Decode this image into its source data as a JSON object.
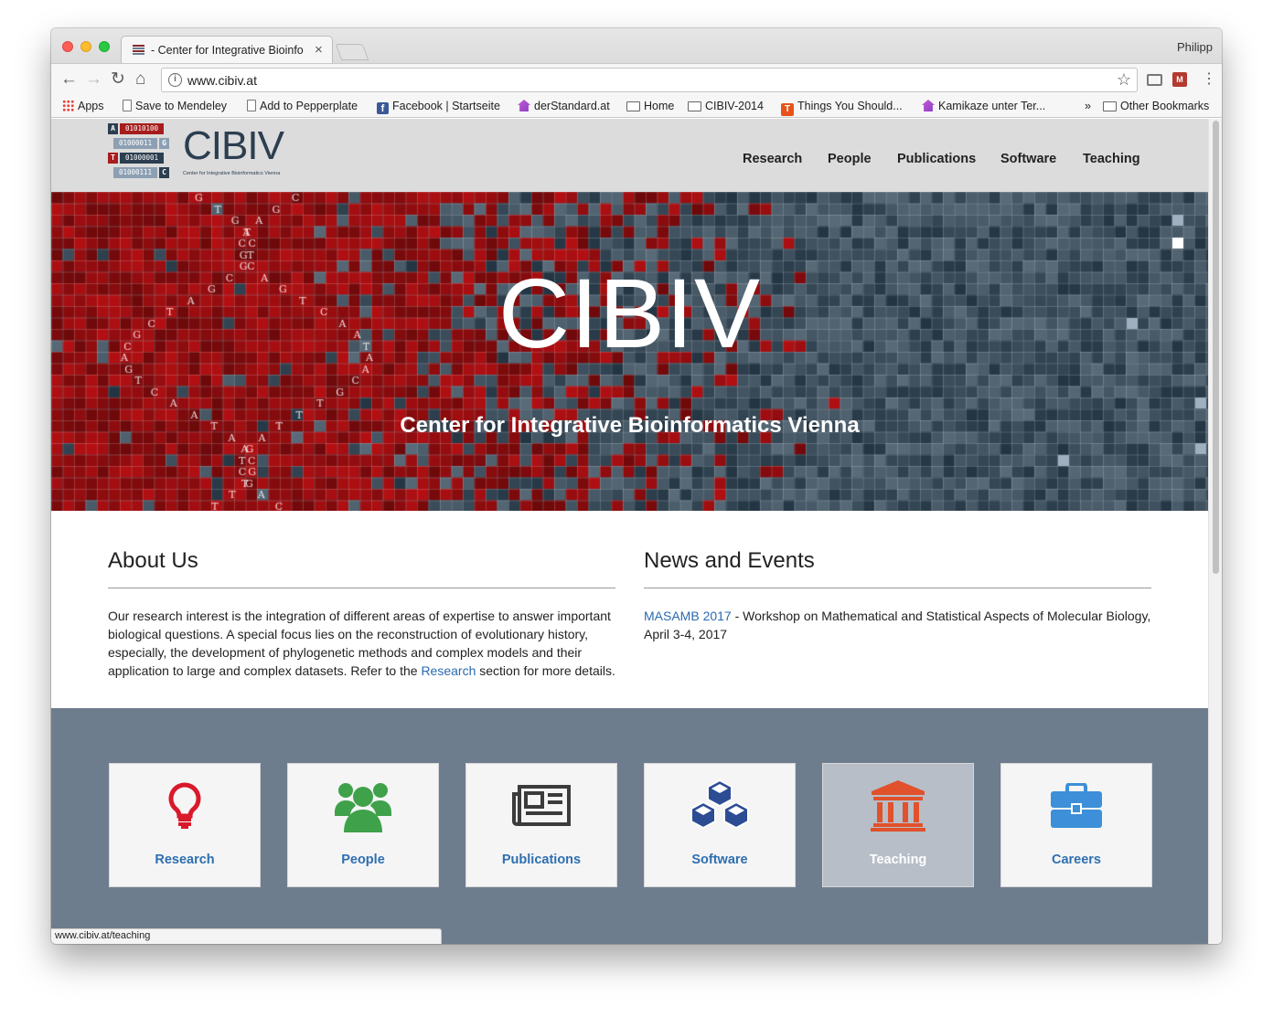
{
  "browser": {
    "tab_title": "- Center for Integrative Bioinfo",
    "tab_close": "×",
    "profile_name": "Philipp",
    "url": "www.cibiv.at",
    "status_url": "www.cibiv.at/teaching",
    "bookmarks": [
      {
        "label": "Apps",
        "icon": "apps-icon"
      },
      {
        "label": "Save to Mendeley",
        "icon": "page-icon"
      },
      {
        "label": "Add to Pepperplate",
        "icon": "page-icon"
      },
      {
        "label": "Facebook | Startseite",
        "icon": "facebook-icon"
      },
      {
        "label": "derStandard.at",
        "icon": "house-icon"
      },
      {
        "label": "Home",
        "icon": "folder-icon"
      },
      {
        "label": "CIBIV-2014",
        "icon": "folder-icon"
      },
      {
        "label": "Things You Should...",
        "icon": "t-icon"
      },
      {
        "label": "Kamikaze unter Ter...",
        "icon": "house-icon"
      }
    ],
    "bookmarks_overflow": "»",
    "other_bookmarks": "Other Bookmarks"
  },
  "site": {
    "logo": {
      "wordmark": "CIBIV",
      "subtitle": "Center for Integrative Bioinformatics Vienna",
      "rows": [
        {
          "letter": "A",
          "bits": "01010100"
        },
        {
          "letter": "G",
          "bits": "01000011"
        },
        {
          "letter": "T",
          "bits": "01000001"
        },
        {
          "letter": "C",
          "bits": "01000111"
        }
      ]
    },
    "nav": [
      "Research",
      "People",
      "Publications",
      "Software",
      "Teaching"
    ],
    "hero": {
      "title": "CIBIV",
      "subtitle": "Center for Integrative Bioinformatics Vienna"
    },
    "about": {
      "heading": "About Us",
      "text_before_link": "Our research interest is the integration of different areas of expertise to answer important biological questions. A special focus lies on the reconstruction of evolutionary history, especially, the development of phylogenetic methods and complex models and their application to large and complex datasets. Refer to the ",
      "link": "Research",
      "text_after_link": " section for more details."
    },
    "news": {
      "heading": "News and Events",
      "item_link": "MASAMB 2017",
      "item_text": " - Workshop on Mathematical and Statistical Aspects of Molecular Biology, April 3-4, 2017"
    },
    "tiles": [
      {
        "label": "Research",
        "icon": "lightbulb-icon",
        "color": "#d9192b"
      },
      {
        "label": "People",
        "icon": "people-icon",
        "color": "#3fa14a"
      },
      {
        "label": "Publications",
        "icon": "newspaper-icon",
        "color": "#3b3b3b"
      },
      {
        "label": "Software",
        "icon": "cubes-icon",
        "color": "#2c4c94"
      },
      {
        "label": "Teaching",
        "icon": "institution-icon",
        "color": "#e1512b",
        "active": true
      },
      {
        "label": "Careers",
        "icon": "briefcase-icon",
        "color": "#3c8fd8"
      }
    ]
  }
}
